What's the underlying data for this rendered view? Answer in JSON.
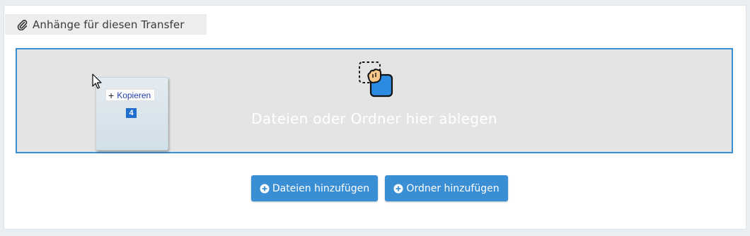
{
  "attachments": {
    "section_title": "Anhänge für diesen Transfer",
    "section_icon": "paperclip-icon"
  },
  "dropzone": {
    "hint_text": "Dateien oder Ordner hier ablegen",
    "illustration_icon": "drag-and-drop-icon",
    "border_color": "#3a8ed4"
  },
  "drag_ghost": {
    "action_label": "Kopieren",
    "action_icon": "plus-icon",
    "item_count": "4"
  },
  "buttons": {
    "add_files_label": "Dateien hinzufügen",
    "add_folder_label": "Ordner hinzufügen",
    "icon": "plus-circle-icon",
    "color": "#3a8ed4"
  }
}
